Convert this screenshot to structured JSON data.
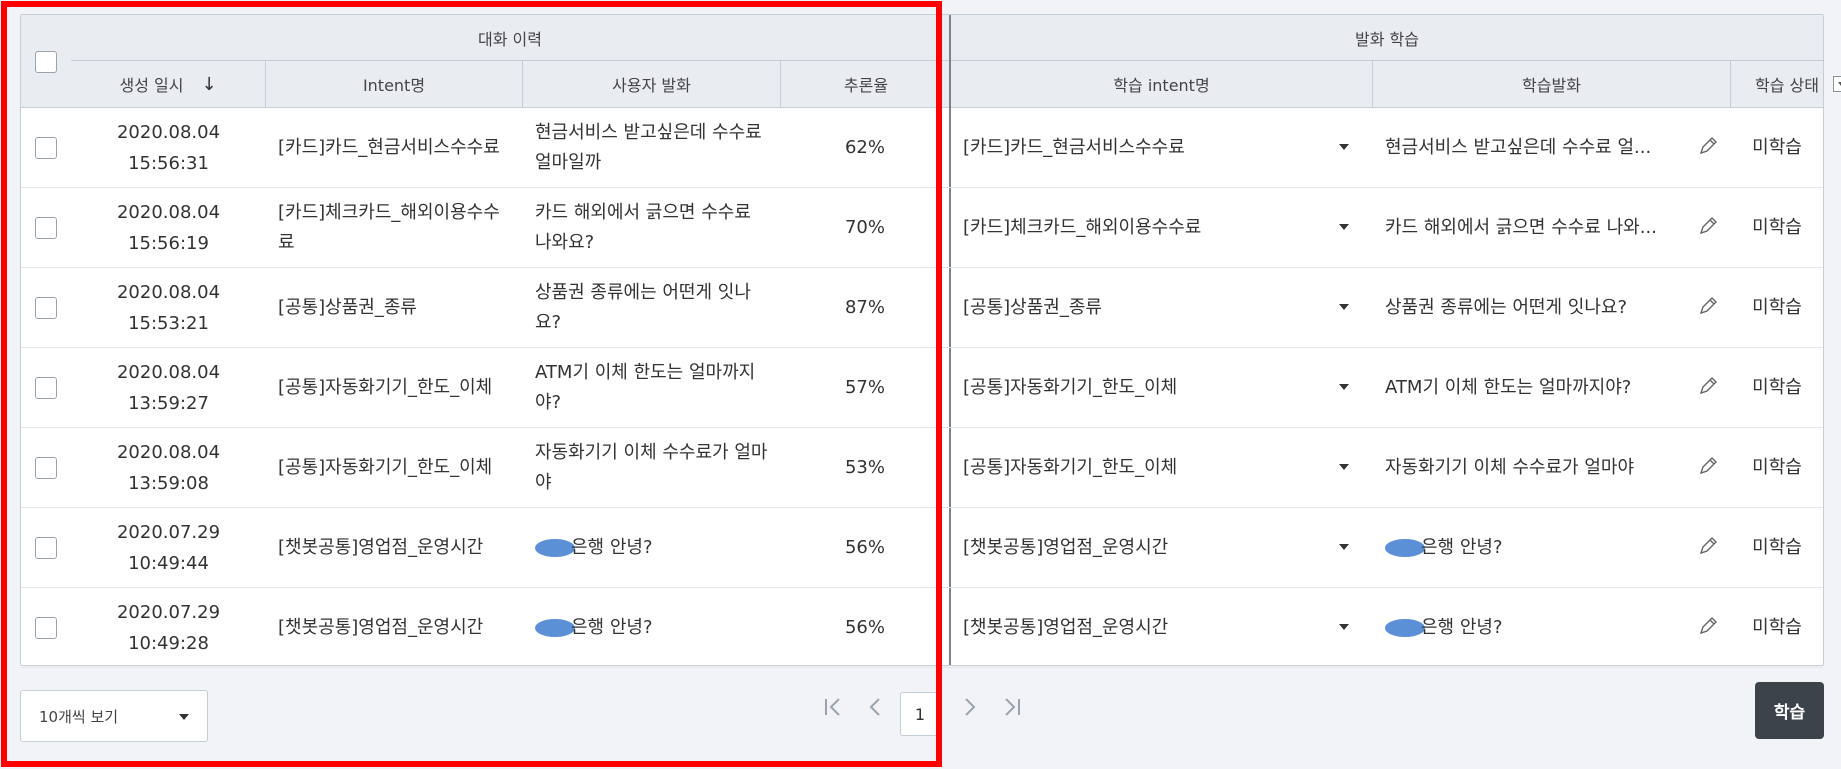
{
  "header": {
    "group_history": "대화 이력",
    "group_learning": "발화 학습",
    "col_created": "생성 일시",
    "col_intent": "Intent명",
    "col_utterance": "사용자 발화",
    "col_score": "추론율",
    "col_learn_intent": "학습 intent명",
    "col_learn_utterance": "학습발화",
    "col_learn_status": "학습 상태",
    "sort_icon": "arrow-down-icon",
    "filter_icon": "filter-dropdown-icon"
  },
  "rows": [
    {
      "date": "2020.08.04",
      "time": "15:56:31",
      "intent": "[카드]카드_현금서비스수수료",
      "utterance": "현금서비스 받고싶은데 수수료 얼마일까",
      "score": "62%",
      "learn_intent": "[카드]카드_현금서비스수수료",
      "learn_utterance": "현금서비스 받고싶은데 수수료 얼...",
      "status": "미학습",
      "masked": false
    },
    {
      "date": "2020.08.04",
      "time": "15:56:19",
      "intent": "[카드]체크카드_해외이용수수료",
      "utterance": "카드 해외에서 긁으면 수수료 나와요?",
      "score": "70%",
      "learn_intent": "[카드]체크카드_해외이용수수료",
      "learn_utterance": "카드 해외에서 긁으면 수수료 나와...",
      "status": "미학습",
      "masked": false
    },
    {
      "date": "2020.08.04",
      "time": "15:53:21",
      "intent": "[공통]상품권_종류",
      "utterance": "상품권 종류에는 어떤게 잇나요?",
      "score": "87%",
      "learn_intent": "[공통]상품권_종류",
      "learn_utterance": "상품권 종류에는 어떤게 잇나요?",
      "status": "미학습",
      "masked": false
    },
    {
      "date": "2020.08.04",
      "time": "13:59:27",
      "intent": "[공통]자동화기기_한도_이체",
      "utterance": "ATM기 이체 한도는 얼마까지야?",
      "score": "57%",
      "learn_intent": "[공통]자동화기기_한도_이체",
      "learn_utterance": "ATM기 이체 한도는 얼마까지야?",
      "status": "미학습",
      "masked": false
    },
    {
      "date": "2020.08.04",
      "time": "13:59:08",
      "intent": "[공통]자동화기기_한도_이체",
      "utterance": "자동화기기 이체 수수료가 얼마야",
      "score": "53%",
      "learn_intent": "[공통]자동화기기_한도_이체",
      "learn_utterance": "자동화기기 이체 수수료가 얼마야",
      "status": "미학습",
      "masked": false
    },
    {
      "date": "2020.07.29",
      "time": "10:49:44",
      "intent": "[챗봇공통]영업점_운영시간",
      "utterance": "은행 안녕?",
      "score": "56%",
      "learn_intent": "[챗봇공통]영업점_운영시간",
      "learn_utterance": "은행 안녕?",
      "status": "미학습",
      "masked": true
    },
    {
      "date": "2020.07.29",
      "time": "10:49:28",
      "intent": "[챗봇공통]영업점_운영시간",
      "utterance": "은행 안녕?",
      "score": "56%",
      "learn_intent": "[챗봇공통]영업점_운영시간",
      "learn_utterance": "은행 안녕?",
      "status": "미학습",
      "masked": true
    }
  ],
  "footer": {
    "page_size": "10개씩 보기",
    "current_page": "1",
    "learn_button": "학습"
  }
}
